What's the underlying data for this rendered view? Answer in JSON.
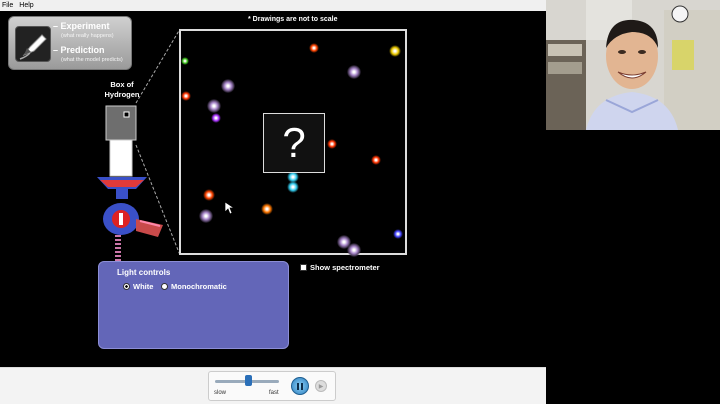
{
  "menu": {
    "file": "File",
    "help": "Help"
  },
  "modes": {
    "experiment": "– Experiment",
    "experiment_sub": "(what really happens)",
    "prediction": "– Prediction",
    "prediction_sub": "(what the model predicts)"
  },
  "note": "* Drawings are not to scale",
  "box_label": "Box of Hydrogen",
  "view": {
    "question_mark": "?"
  },
  "light_controls": {
    "title": "Light controls",
    "options": [
      {
        "label": "White",
        "selected": true
      },
      {
        "label": "Monochromatic",
        "selected": false
      }
    ]
  },
  "spectrometer": {
    "label": "Show spectrometer",
    "checked": false
  },
  "speed": {
    "slow": "slow",
    "fast": "fast",
    "level": 0.5
  },
  "colors": {
    "sim_bg": "#000000",
    "panel": "#6366b8",
    "accent": "#2a6fb8"
  },
  "icons": [
    "pen-icon",
    "pause-icon",
    "step-icon",
    "cursor-icon"
  ]
}
